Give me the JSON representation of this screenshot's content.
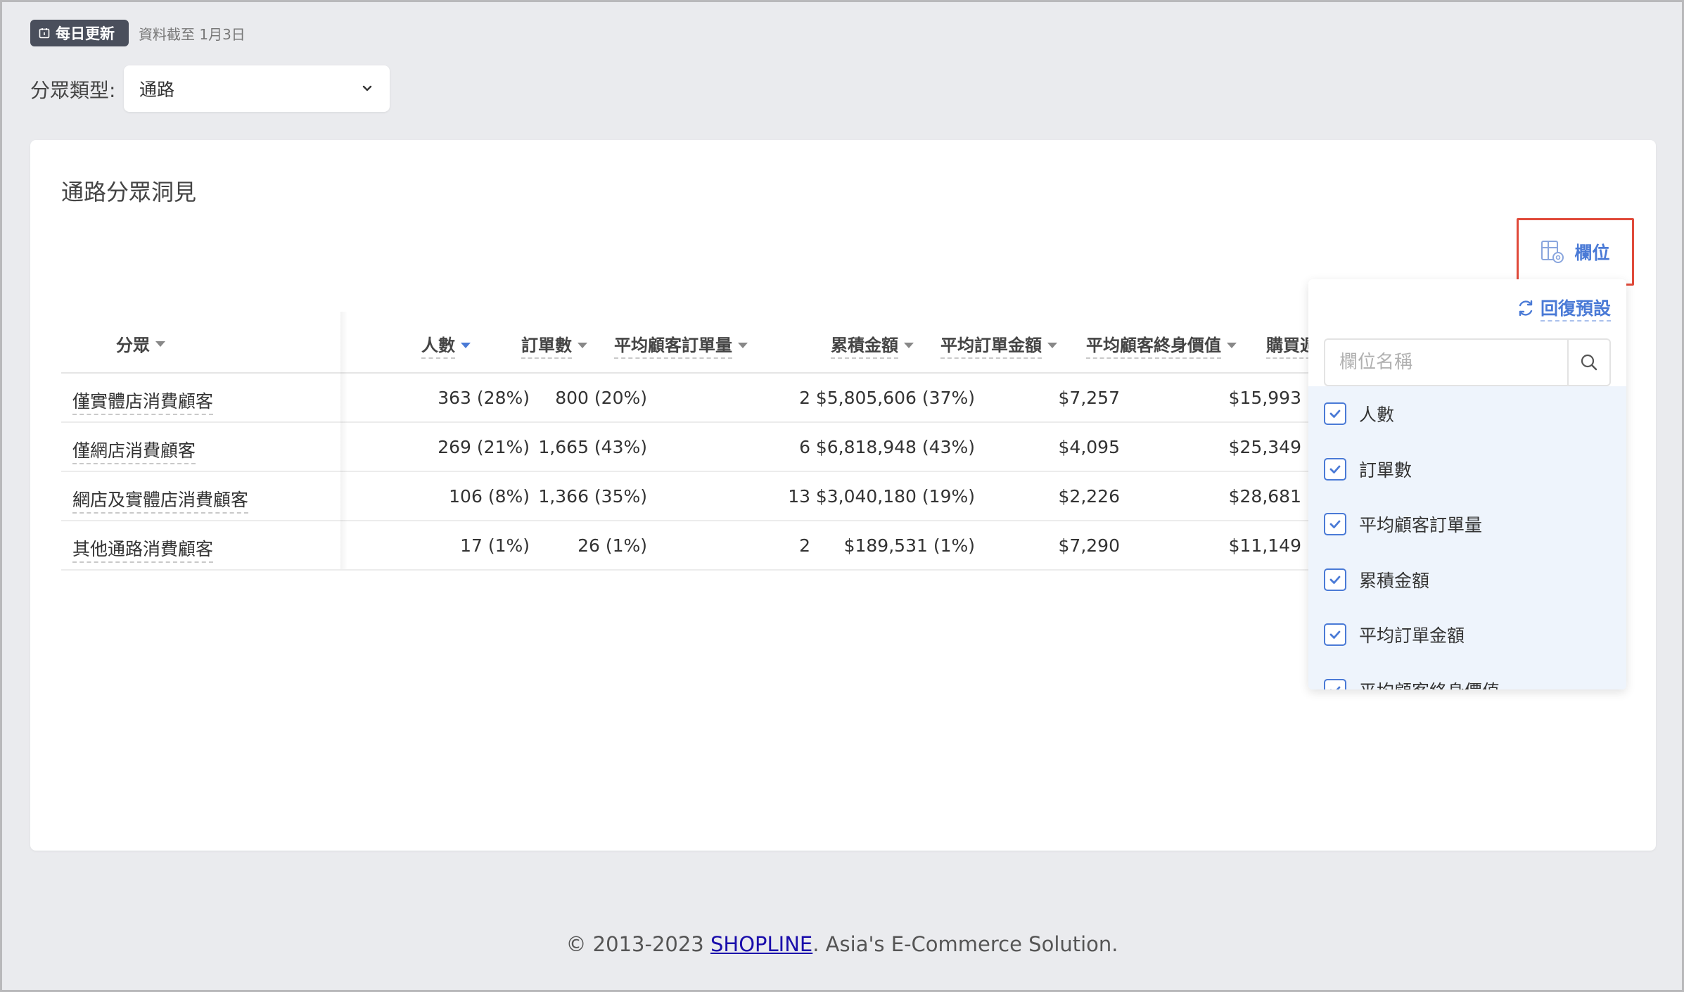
{
  "header": {
    "badge_label": "每日更新",
    "data_note": "資料截至 1月3日"
  },
  "segment": {
    "label": "分眾類型:",
    "selected": "通路"
  },
  "card": {
    "title": "通路分眾洞見"
  },
  "columns_button": {
    "label": "欄位"
  },
  "table": {
    "columns": [
      "分眾",
      "人數",
      "訂單數",
      "平均顧客訂單量",
      "累積金額",
      "平均訂單金額",
      "平均顧客終身價值",
      "購買週"
    ],
    "rows": [
      [
        "僅實體店消費顧客",
        "363 (28%)",
        "800 (20%)",
        "2",
        "$5,805,606 (37%)",
        "$7,257",
        "$15,993"
      ],
      [
        "僅網店消費顧客",
        "269 (21%)",
        "1,665 (43%)",
        "6",
        "$6,818,948 (43%)",
        "$4,095",
        "$25,349"
      ],
      [
        "網店及實體店消費顧客",
        "106 (8%)",
        "1,366 (35%)",
        "13",
        "$3,040,180 (19%)",
        "$2,226",
        "$28,681"
      ],
      [
        "其他通路消費顧客",
        "17 (1%)",
        "26 (1%)",
        "2",
        "$189,531 (1%)",
        "$7,290",
        "$11,149"
      ]
    ]
  },
  "column_panel": {
    "reset_label": "回復預設",
    "search_placeholder": "欄位名稱",
    "options": [
      "人數",
      "訂單數",
      "平均顧客訂單量",
      "累積金額",
      "平均訂單金額",
      "平均顧客終身價值"
    ]
  },
  "footer": {
    "prefix": "© 2013-2023 ",
    "brand": "SHOPLINE",
    "suffix": ". Asia's E-Commerce Solution."
  },
  "colors": {
    "accent": "#4a7ad6",
    "highlight_border": "#e04a3a",
    "badge_bg": "#4a4f5c",
    "page_bg": "#eaebee",
    "option_list_bg": "#eef4fc"
  }
}
